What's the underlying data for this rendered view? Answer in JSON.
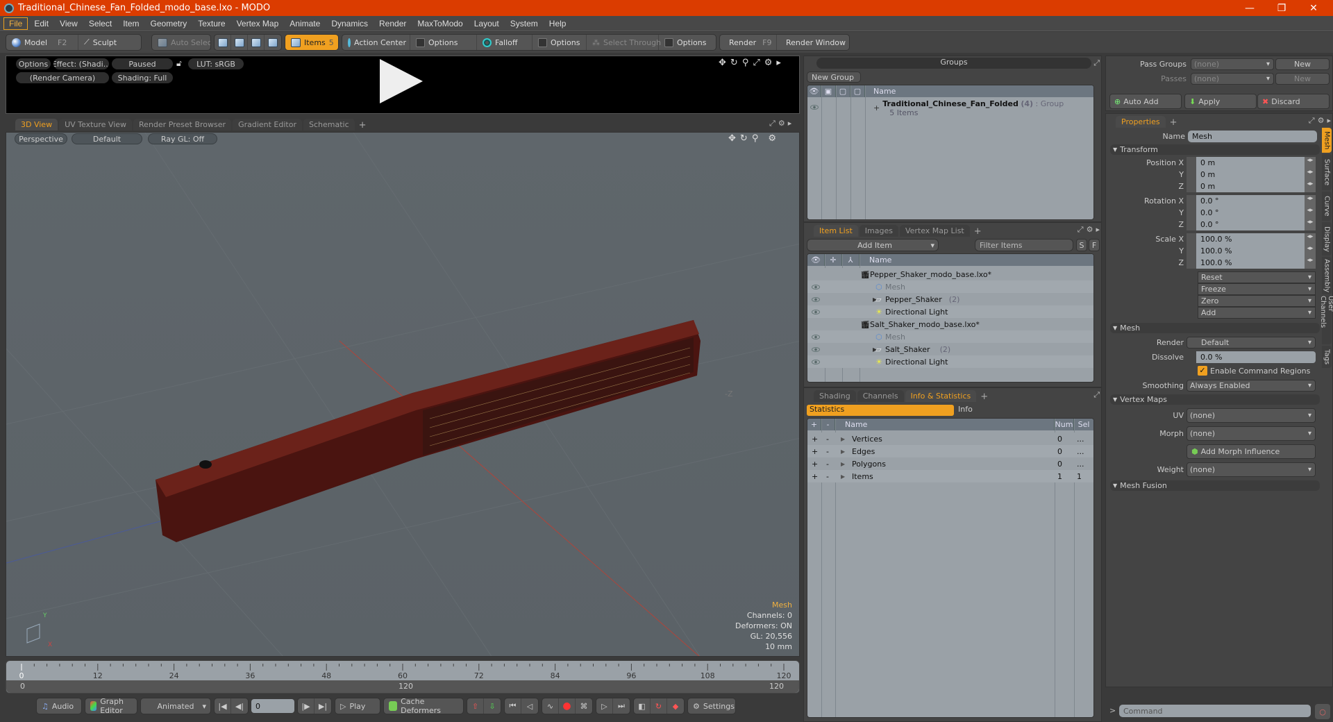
{
  "window": {
    "title": "Traditional_Chinese_Fan_Folded_modo_base.lxo - MODO",
    "controls": {
      "minimize": "—",
      "restore": "❐",
      "close": "✕"
    }
  },
  "menubar": [
    "File",
    "Edit",
    "View",
    "Select",
    "Item",
    "Geometry",
    "Texture",
    "Vertex Map",
    "Animate",
    "Dynamics",
    "Render",
    "MaxToModo",
    "Layout",
    "System",
    "Help"
  ],
  "toolbar": {
    "model": "Model",
    "model_key": "F2",
    "sculpt": "Sculpt",
    "auto_select": "Auto Select",
    "items": "Items",
    "items_key": "5",
    "action_center": "Action Center",
    "options1": "Options",
    "falloff": "Falloff",
    "options2": "Options",
    "select_through": "Select Through",
    "options3": "Options",
    "render": "Render",
    "render_key": "F9",
    "render_window": "Render Window"
  },
  "render_preview": {
    "options": "Options",
    "effect": "Effect: (Shadi...",
    "paused": "Paused",
    "lut": "LUT: sRGB",
    "camera": "(Render Camera)",
    "shading": "Shading: Full"
  },
  "viewport_tabs": [
    "3D View",
    "UV Texture View",
    "Render Preset Browser",
    "Gradient Editor",
    "Schematic",
    "+"
  ],
  "viewport": {
    "perspective": "Perspective",
    "default": "Default",
    "raygl": "Ray GL: Off",
    "axis_label_z": "-Z",
    "hud": {
      "title": "Mesh",
      "channels": "Channels: 0",
      "deformers": "Deformers: ON",
      "gl": "GL: 20,556",
      "scale": "10 mm"
    }
  },
  "timeline": {
    "ticks": [
      "0",
      "12",
      "24",
      "36",
      "48",
      "60",
      "72",
      "84",
      "96",
      "108",
      "120"
    ],
    "range_start": "0",
    "range_mid": "120",
    "range_end": "120"
  },
  "transport": {
    "audio": "Audio",
    "graph_editor": "Graph Editor",
    "animated": "Animated",
    "frame": "0",
    "play": "Play",
    "cache_deformers": "Cache Deformers",
    "settings": "Settings"
  },
  "groups": {
    "title": "Groups",
    "new_group": "New Group",
    "col_name": "Name",
    "row": {
      "name": "Traditional_Chinese_Fan_Folded",
      "count": "(4)",
      "type": ": Group",
      "sub": "5 Items"
    }
  },
  "item_list": {
    "tabs": [
      "Item List",
      "Images",
      "Vertex Map List",
      "+"
    ],
    "add_item": "Add Item",
    "filter_placeholder": "Filter Items",
    "s_btn": "S",
    "f_btn": "F",
    "col_name": "Name",
    "rows": [
      {
        "name": "Pepper_Shaker_modo_base.lxo*",
        "type": "scene",
        "count": ""
      },
      {
        "name": "Mesh",
        "type": "mesh",
        "count": ""
      },
      {
        "name": "Pepper_Shaker",
        "type": "group",
        "count": "(2)"
      },
      {
        "name": "Directional Light",
        "type": "light",
        "count": ""
      },
      {
        "name": "Salt_Shaker_modo_base.lxo*",
        "type": "scene",
        "count": ""
      },
      {
        "name": "Mesh",
        "type": "mesh",
        "count": ""
      },
      {
        "name": "Salt_Shaker",
        "type": "group",
        "count": "(2)"
      },
      {
        "name": "Directional Light",
        "type": "light",
        "count": ""
      }
    ]
  },
  "info_stats": {
    "tabs": [
      "Shading",
      "Channels",
      "Info & Statistics",
      "+"
    ],
    "subtabs": [
      "Statistics",
      "Info"
    ],
    "cols": [
      "+",
      "-",
      "Name",
      "Num",
      "Sel"
    ],
    "rows": [
      {
        "name": "Vertices",
        "num": "0",
        "sel": "..."
      },
      {
        "name": "Edges",
        "num": "0",
        "sel": "..."
      },
      {
        "name": "Polygons",
        "num": "0",
        "sel": "..."
      },
      {
        "name": "Items",
        "num": "1",
        "sel": "1"
      }
    ]
  },
  "passes": {
    "pass_groups_label": "Pass Groups",
    "pass_groups_value": "(none)",
    "new1": "New",
    "passes_label": "Passes",
    "passes_value": "(none)",
    "new2": "New",
    "auto_add": "Auto Add",
    "apply": "Apply",
    "discard": "Discard"
  },
  "properties": {
    "tab": "Properties",
    "plus": "+",
    "name_label": "Name",
    "name_value": "Mesh",
    "transform": "Transform",
    "position": [
      {
        "label": "Position X",
        "value": "0 m"
      },
      {
        "label": "Y",
        "value": "0 m"
      },
      {
        "label": "Z",
        "value": "0 m"
      }
    ],
    "rotation": [
      {
        "label": "Rotation X",
        "value": "0.0 °"
      },
      {
        "label": "Y",
        "value": "0.0 °"
      },
      {
        "label": "Z",
        "value": "0.0 °"
      }
    ],
    "scale": [
      {
        "label": "Scale X",
        "value": "100.0 %"
      },
      {
        "label": "Y",
        "value": "100.0 %"
      },
      {
        "label": "Z",
        "value": "100.0 %"
      }
    ],
    "actions": [
      "Reset",
      "Freeze",
      "Zero",
      "Add"
    ],
    "mesh_section": "Mesh",
    "render_label": "Render",
    "render_value": "Default",
    "dissolve_label": "Dissolve",
    "dissolve_value": "0.0 %",
    "enable_cmd_regions": "Enable Command Regions",
    "smoothing_label": "Smoothing",
    "smoothing_value": "Always Enabled",
    "vertex_maps": "Vertex Maps",
    "uv_label": "UV",
    "uv_value": "(none)",
    "morph_label": "Morph",
    "morph_value": "(none)",
    "add_morph": "Add Morph Influence",
    "weight_label": "Weight",
    "weight_value": "(none)",
    "mesh_fusion": "Mesh Fusion",
    "side_tabs": [
      "Mesh",
      "Surface",
      "Curve",
      "Display",
      "Assembly",
      "User Channels",
      "Tags"
    ]
  },
  "command": {
    "prompt": ">",
    "placeholder": "Command"
  },
  "colors": {
    "accent": "#f0a020",
    "titlebar": "#db3c00",
    "list_bg": "#9aa1a7"
  }
}
